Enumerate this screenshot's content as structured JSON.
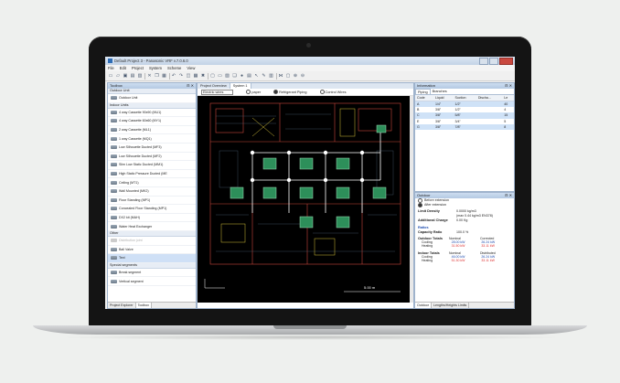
{
  "app": {
    "title": "Default Project 3 - Panasonic VRF v.7.0.6.0",
    "menu": [
      "File",
      "Edit",
      "Project",
      "System",
      "Scheme",
      "View"
    ]
  },
  "toolbox": {
    "title": "Toolbox",
    "groups": {
      "outdoor": "Outdoor Unit",
      "indoor": "Indoor Units",
      "other": "Other",
      "special": "Special segments"
    },
    "outdoor_items": [
      "Outdoor Unit"
    ],
    "indoor_items": [
      "4 way Cassette 90x90 (MU1)",
      "4 way Cassette 60x60 (MY1)",
      "2 way Cassette (ML1)",
      "1 way Cassette (MQ1)",
      "Low Silhouette Ducted (MF3)",
      "Low Silhouette Ducted (MF2)",
      "Slim Low Static Ducted (MM1)",
      "High Static Pressure Ducted (ME",
      "Ceiling (MT1)",
      "Wall Mounted (MK2)",
      "Floor Standing (MP1)",
      "Concealed Floor Standing (MP1)",
      "DX2 kit (MAH)",
      "Water Heat Exchanger"
    ],
    "other_items": [
      "Distribution joint",
      "Ball Valve",
      "Text"
    ],
    "special_items": [
      "Break segment",
      "Vertical segment"
    ],
    "bottom_tabs": [
      "Project Explorer",
      "Toolbox"
    ]
  },
  "document": {
    "tabs": [
      "Project Overview",
      "System 1"
    ],
    "layer_select": "Electric wires",
    "options": [
      "paper",
      "Refrigerant Piping",
      "Control Wires"
    ],
    "scale_label": "5.00 m"
  },
  "information": {
    "title": "Information",
    "tabs": [
      "Piping",
      "Branches"
    ],
    "columns": [
      "Code",
      "Liquid",
      "Suction",
      "Discha...",
      "Le"
    ],
    "rows": [
      [
        "A",
        "1/4\"",
        "1/2\"",
        "",
        "40"
      ],
      [
        "B",
        "3/8\"",
        "1/2\"",
        "",
        "4"
      ],
      [
        "C",
        "3/8\"",
        "5/8\"",
        "",
        "15"
      ],
      [
        "E",
        "3/8\"",
        "3/4\"",
        "",
        "5"
      ],
      [
        "G",
        "3/8\"",
        "7/8\"",
        "",
        "8"
      ]
    ]
  },
  "outdoor": {
    "title": "Outdoor",
    "radio_before": "Before extension",
    "radio_after": "After extension",
    "limit_density_label": "Limit Density",
    "limit_density_value": "0.0000 kg/m3",
    "limit_density_sub": "(max 0.44 kg/m3 EN378)",
    "additional_charge_label": "Additional Charge",
    "additional_charge_value": "0.00 Kg",
    "ratios_title": "Ratios",
    "capacity_ratio_label": "Capacity Ratio",
    "capacity_ratio_value": "100.0 %",
    "outdoor_totals": "Outdoor Totals",
    "col_nominal": "Nominal",
    "col_corrected": "Corrected",
    "cooling_label": "Cooling",
    "heating_label": "Heating",
    "outdoor_cooling_nominal": "28.00 kW",
    "outdoor_cooling_corrected": "26.24 kW",
    "outdoor_heating_nominal": "31.50 kW",
    "outdoor_heating_corrected": "33.11 kW",
    "indoor_totals": "Indoor Totals",
    "col_distributed": "Distributed",
    "indoor_cooling_nominal": "46.00 kW",
    "indoor_cooling_distributed": "26.24 kW",
    "indoor_heating_nominal": "51.30 kW",
    "indoor_heating_distributed": "33.11 kW",
    "bottom_tabs": [
      "Outdoor",
      "Lengths/Heights Limits"
    ]
  }
}
